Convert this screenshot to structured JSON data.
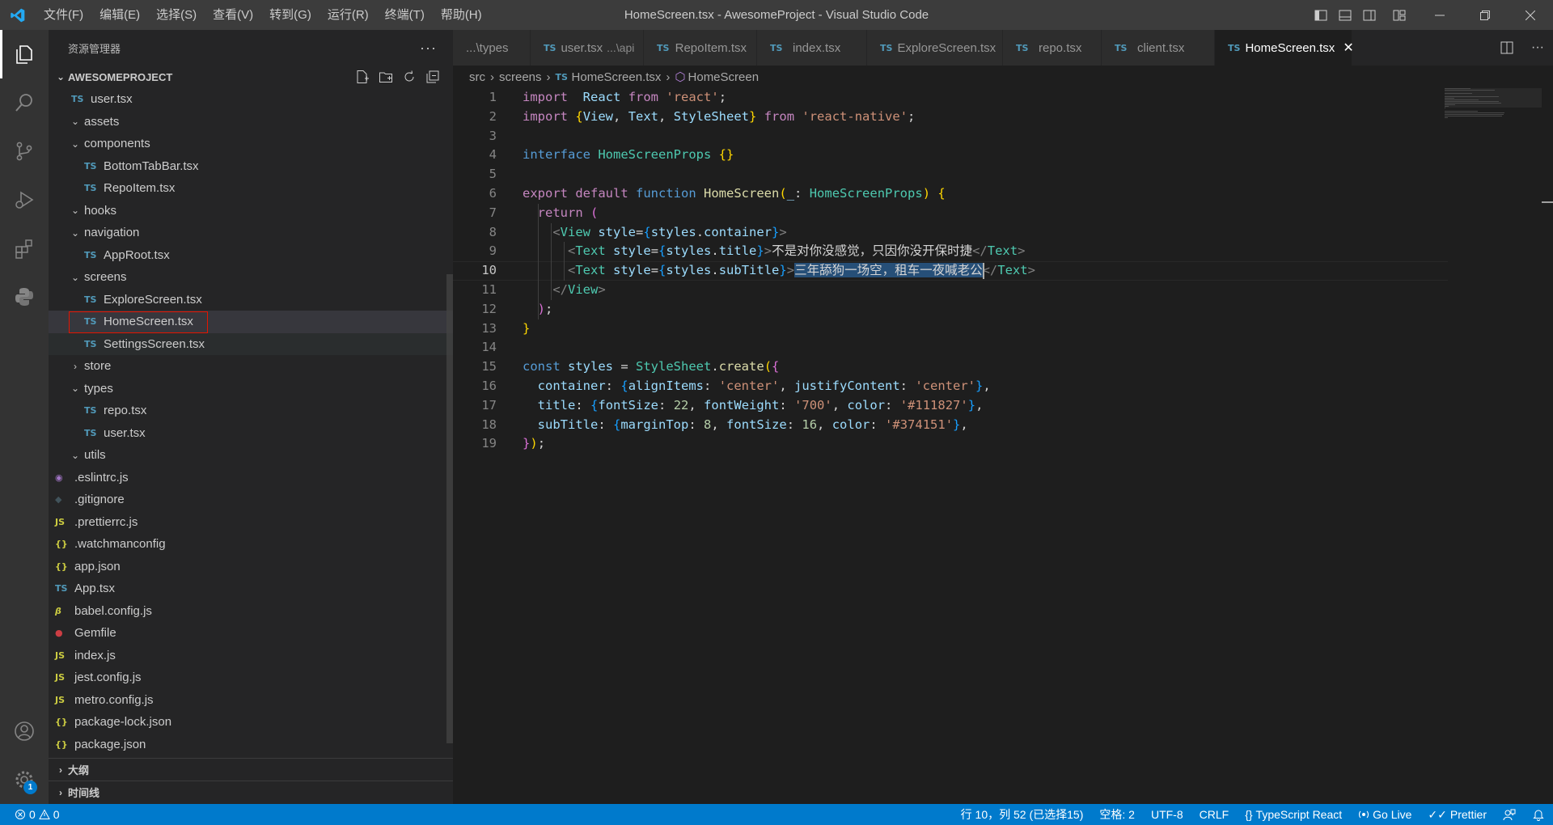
{
  "window": {
    "title": "HomeScreen.tsx - AwesomeProject - Visual Studio Code",
    "menu": [
      "文件(F)",
      "编辑(E)",
      "选择(S)",
      "查看(V)",
      "转到(G)",
      "运行(R)",
      "终端(T)",
      "帮助(H)"
    ]
  },
  "sidebar": {
    "header": "资源管理器",
    "more": "···",
    "project": "AWESOMEPROJECT",
    "tree": [
      {
        "label": "user.tsx",
        "type": "file",
        "icon": "TS",
        "indent": 1
      },
      {
        "label": "assets",
        "type": "folder",
        "open": true,
        "indent": 1
      },
      {
        "label": "components",
        "type": "folder",
        "open": true,
        "indent": 1
      },
      {
        "label": "BottomTabBar.tsx",
        "type": "file",
        "icon": "TS",
        "indent": 2
      },
      {
        "label": "RepoItem.tsx",
        "type": "file",
        "icon": "TS",
        "indent": 2
      },
      {
        "label": "hooks",
        "type": "folder",
        "open": true,
        "indent": 1
      },
      {
        "label": "navigation",
        "type": "folder",
        "open": true,
        "indent": 1
      },
      {
        "label": "AppRoot.tsx",
        "type": "file",
        "icon": "TS",
        "indent": 2
      },
      {
        "label": "screens",
        "type": "folder",
        "open": true,
        "indent": 1
      },
      {
        "label": "ExploreScreen.tsx",
        "type": "file",
        "icon": "TS",
        "indent": 2
      },
      {
        "label": "HomeScreen.tsx",
        "type": "file",
        "icon": "TS",
        "indent": 2,
        "selected": true
      },
      {
        "label": "SettingsScreen.tsx",
        "type": "file",
        "icon": "TS",
        "indent": 2,
        "hover": true
      },
      {
        "label": "store",
        "type": "folder",
        "open": false,
        "indent": 1
      },
      {
        "label": "types",
        "type": "folder",
        "open": true,
        "indent": 1
      },
      {
        "label": "repo.tsx",
        "type": "file",
        "icon": "TS",
        "indent": 2
      },
      {
        "label": "user.tsx",
        "type": "file",
        "icon": "TS",
        "indent": 2
      },
      {
        "label": "utils",
        "type": "folder",
        "open": true,
        "indent": 1
      },
      {
        "label": ".eslintrc.js",
        "type": "file",
        "icon": "eslint",
        "indent": 0
      },
      {
        "label": ".gitignore",
        "type": "file",
        "icon": "git",
        "indent": 0
      },
      {
        "label": ".prettierrc.js",
        "type": "file",
        "icon": "JS",
        "indent": 0
      },
      {
        "label": ".watchmanconfig",
        "type": "file",
        "icon": "{}",
        "indent": 0
      },
      {
        "label": "app.json",
        "type": "file",
        "icon": "{}",
        "indent": 0
      },
      {
        "label": "App.tsx",
        "type": "file",
        "icon": "TS",
        "indent": 0
      },
      {
        "label": "babel.config.js",
        "type": "file",
        "icon": "babel",
        "indent": 0
      },
      {
        "label": "Gemfile",
        "type": "file",
        "icon": "gem",
        "indent": 0
      },
      {
        "label": "index.js",
        "type": "file",
        "icon": "JS",
        "indent": 0
      },
      {
        "label": "jest.config.js",
        "type": "file",
        "icon": "JS",
        "indent": 0
      },
      {
        "label": "metro.config.js",
        "type": "file",
        "icon": "JS",
        "indent": 0
      },
      {
        "label": "package-lock.json",
        "type": "file",
        "icon": "{}",
        "indent": 0
      },
      {
        "label": "package.json",
        "type": "file",
        "icon": "{}",
        "indent": 0
      }
    ],
    "outline": "大纲",
    "timeline": "时间线"
  },
  "tabs": [
    {
      "label": "...\\types",
      "icon": ""
    },
    {
      "label": "user.tsx",
      "sub": "...\\api",
      "icon": "TS"
    },
    {
      "label": "RepoItem.tsx",
      "icon": "TS"
    },
    {
      "label": "index.tsx",
      "icon": "TS"
    },
    {
      "label": "ExploreScreen.tsx",
      "icon": "TS"
    },
    {
      "label": "repo.tsx",
      "icon": "TS"
    },
    {
      "label": "client.tsx",
      "icon": "TS"
    },
    {
      "label": "HomeScreen.tsx",
      "icon": "TS",
      "active": true
    }
  ],
  "breadcrumb": [
    "src",
    "screens",
    "HomeScreen.tsx",
    "HomeScreen"
  ],
  "editor": {
    "current_line": 10,
    "lines": [
      [
        [
          "kw2",
          "import"
        ],
        [
          "",
          "  "
        ],
        [
          "var",
          "React"
        ],
        [
          "",
          " "
        ],
        [
          "kw2",
          "from"
        ],
        [
          "",
          " "
        ],
        [
          "str",
          "'react'"
        ],
        [
          "",
          ";"
        ]
      ],
      [
        [
          "kw2",
          "import"
        ],
        [
          "",
          " "
        ],
        [
          "brk1",
          "{"
        ],
        [
          "var",
          "View"
        ],
        [
          "",
          ", "
        ],
        [
          "var",
          "Text"
        ],
        [
          "",
          ", "
        ],
        [
          "var",
          "StyleSheet"
        ],
        [
          "brk1",
          "}"
        ],
        [
          "",
          " "
        ],
        [
          "kw2",
          "from"
        ],
        [
          "",
          " "
        ],
        [
          "str",
          "'react-native'"
        ],
        [
          "",
          ";"
        ]
      ],
      [],
      [
        [
          "kw",
          "interface"
        ],
        [
          "",
          " "
        ],
        [
          "typ",
          "HomeScreenProps"
        ],
        [
          "",
          " "
        ],
        [
          "brk1",
          "{}"
        ]
      ],
      [],
      [
        [
          "kw2",
          "export"
        ],
        [
          "",
          " "
        ],
        [
          "kw2",
          "default"
        ],
        [
          "",
          " "
        ],
        [
          "kw",
          "function"
        ],
        [
          "",
          " "
        ],
        [
          "fn",
          "HomeScreen"
        ],
        [
          "brk1",
          "("
        ],
        [
          "var",
          "_"
        ],
        [
          "",
          ": "
        ],
        [
          "typ",
          "HomeScreenProps"
        ],
        [
          "brk1",
          ")"
        ],
        [
          "",
          " "
        ],
        [
          "brk1",
          "{"
        ]
      ],
      [
        [
          "",
          "  "
        ],
        [
          "kw2",
          "return"
        ],
        [
          "",
          " "
        ],
        [
          "brk2",
          "("
        ]
      ],
      [
        [
          "",
          "    "
        ],
        [
          "pun",
          "<"
        ],
        [
          "typ",
          "View"
        ],
        [
          "",
          " "
        ],
        [
          "var",
          "style"
        ],
        [
          "",
          "="
        ],
        [
          "brk3",
          "{"
        ],
        [
          "var",
          "styles"
        ],
        [
          "",
          "."
        ],
        [
          "var",
          "container"
        ],
        [
          "brk3",
          "}"
        ],
        [
          "pun",
          ">"
        ]
      ],
      [
        [
          "",
          "      "
        ],
        [
          "pun",
          "<"
        ],
        [
          "typ",
          "Text"
        ],
        [
          "",
          " "
        ],
        [
          "var",
          "style"
        ],
        [
          "",
          "="
        ],
        [
          "brk3",
          "{"
        ],
        [
          "var",
          "styles"
        ],
        [
          "",
          "."
        ],
        [
          "var",
          "title"
        ],
        [
          "brk3",
          "}"
        ],
        [
          "pun",
          ">"
        ],
        [
          "",
          "不是对你没感觉，只因你没开保时捷"
        ],
        [
          "pun",
          "</"
        ],
        [
          "typ",
          "Text"
        ],
        [
          "pun",
          ">"
        ]
      ],
      [
        [
          "",
          "      "
        ],
        [
          "pun",
          "<"
        ],
        [
          "typ",
          "Text"
        ],
        [
          "",
          " "
        ],
        [
          "var",
          "style"
        ],
        [
          "",
          "="
        ],
        [
          "brk3",
          "{"
        ],
        [
          "var",
          "styles"
        ],
        [
          "",
          "."
        ],
        [
          "var",
          "subTitle"
        ],
        [
          "brk3",
          "}"
        ],
        [
          "pun",
          ">"
        ],
        [
          "sel",
          "三年舔狗一场空，租车一夜喊老公"
        ],
        [
          "pun",
          "</"
        ],
        [
          "typ",
          "Text"
        ],
        [
          "pun",
          ">"
        ]
      ],
      [
        [
          "",
          "    "
        ],
        [
          "pun",
          "</"
        ],
        [
          "typ",
          "View"
        ],
        [
          "pun",
          ">"
        ]
      ],
      [
        [
          "",
          "  "
        ],
        [
          "brk2",
          ")"
        ],
        [
          "",
          ";"
        ]
      ],
      [
        [
          "brk1",
          "}"
        ]
      ],
      [],
      [
        [
          "kw",
          "const"
        ],
        [
          "",
          " "
        ],
        [
          "var",
          "styles"
        ],
        [
          "",
          " = "
        ],
        [
          "typ",
          "StyleSheet"
        ],
        [
          "",
          "."
        ],
        [
          "fn",
          "create"
        ],
        [
          "brk1",
          "("
        ],
        [
          "brk2",
          "{"
        ]
      ],
      [
        [
          "",
          "  "
        ],
        [
          "var",
          "container"
        ],
        [
          "",
          ": "
        ],
        [
          "brk3",
          "{"
        ],
        [
          "var",
          "alignItems"
        ],
        [
          "",
          ": "
        ],
        [
          "str",
          "'center'"
        ],
        [
          "",
          ", "
        ],
        [
          "var",
          "justifyContent"
        ],
        [
          "",
          ": "
        ],
        [
          "str",
          "'center'"
        ],
        [
          "brk3",
          "}"
        ],
        [
          "",
          ","
        ]
      ],
      [
        [
          "",
          "  "
        ],
        [
          "var",
          "title"
        ],
        [
          "",
          ": "
        ],
        [
          "brk3",
          "{"
        ],
        [
          "var",
          "fontSize"
        ],
        [
          "",
          ": "
        ],
        [
          "num",
          "22"
        ],
        [
          "",
          ", "
        ],
        [
          "var",
          "fontWeight"
        ],
        [
          "",
          ": "
        ],
        [
          "str",
          "'700'"
        ],
        [
          "",
          ", "
        ],
        [
          "var",
          "color"
        ],
        [
          "",
          ": "
        ],
        [
          "str",
          "'#111827'"
        ],
        [
          "brk3",
          "}"
        ],
        [
          "",
          ","
        ]
      ],
      [
        [
          "",
          "  "
        ],
        [
          "var",
          "subTitle"
        ],
        [
          "",
          ": "
        ],
        [
          "brk3",
          "{"
        ],
        [
          "var",
          "marginTop"
        ],
        [
          "",
          ": "
        ],
        [
          "num",
          "8"
        ],
        [
          "",
          ", "
        ],
        [
          "var",
          "fontSize"
        ],
        [
          "",
          ": "
        ],
        [
          "num",
          "16"
        ],
        [
          "",
          ", "
        ],
        [
          "var",
          "color"
        ],
        [
          "",
          ": "
        ],
        [
          "str",
          "'#374151'"
        ],
        [
          "brk3",
          "}"
        ],
        [
          "",
          ","
        ]
      ],
      [
        [
          "brk2",
          "}"
        ],
        [
          "brk1",
          ")"
        ],
        [
          "",
          ";"
        ]
      ]
    ]
  },
  "statusbar": {
    "errors": "0",
    "warnings": "0",
    "position": "行 10，列 52 (已选择15)",
    "indent": "空格: 2",
    "encoding": "UTF-8",
    "eol": "CRLF",
    "language": "TypeScript React",
    "golive": "Go Live",
    "prettier": "Prettier"
  },
  "accounts_badge": "1",
  "colors": {
    "accent": "#007acc",
    "selection": "#264f78",
    "highlight_border": "#e51400"
  }
}
